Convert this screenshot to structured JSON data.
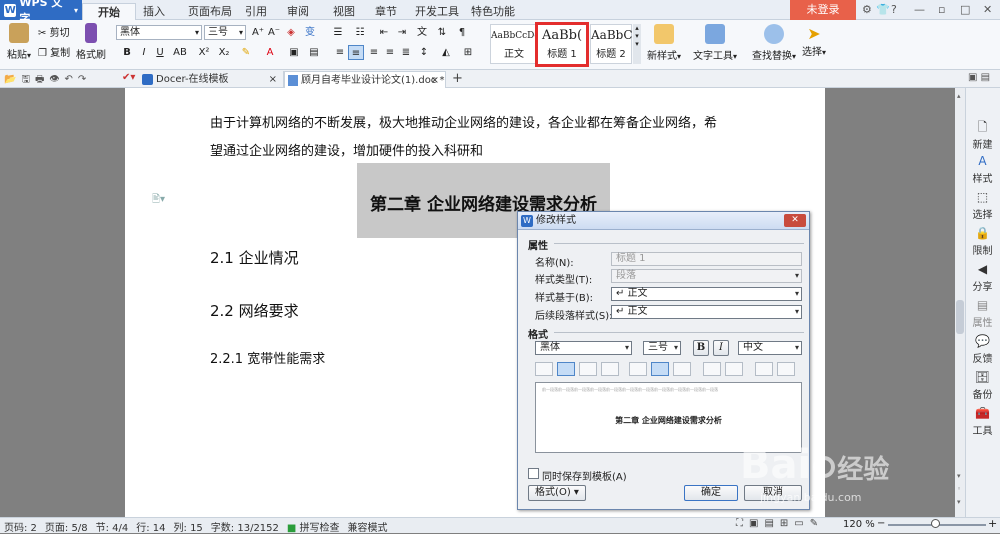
{
  "app": {
    "brand": "WPS 文字",
    "login": "未登录"
  },
  "menu_tabs": [
    "开始",
    "插入",
    "页面布局",
    "引用",
    "审阅",
    "视图",
    "章节",
    "开发工具",
    "特色功能"
  ],
  "ribbon": {
    "paste": "粘贴",
    "cut": "剪切",
    "copy": "复制",
    "format_painter": "格式刷",
    "font": "黑体",
    "size": "三号",
    "styles": [
      {
        "preview": "AaBbCcDd",
        "name": "正文"
      },
      {
        "preview": "AaBb(",
        "name": "标题 1"
      },
      {
        "preview": "AaBbC",
        "name": "标题 2"
      }
    ],
    "new_style": "新样式",
    "text_tools": "文字工具",
    "find_replace": "查找替换",
    "select": "选择"
  },
  "doc_tabs": [
    "Docer-在线模板",
    "顾月自考毕业设计论文(1).doc *"
  ],
  "document": {
    "para1_line1": "由于计算机网络的不断发展，极大地推动企业网络的建设，各企业都在筹备企业网络，希",
    "para1_line2": "望通过企业网络的建设，增加硬件的投入科研和",
    "chapter_heading": "第二章  企业网络建设需求分析",
    "h2_1": "2.1 企业情况",
    "h2_2": "2.2 网络要求",
    "h3_1": "2.2.1 宽带性能需求"
  },
  "sidebar": [
    "新建",
    "样式",
    "选择",
    "限制",
    "分享",
    "属性",
    "反馈",
    "备份",
    "工具"
  ],
  "status": {
    "page_no": "页码: 2",
    "pages": "页面: 5/8",
    "section": "节: 4/4",
    "row": "行: 14",
    "col": "列: 15",
    "words": "字数: 13/2152",
    "spell": "拼写检查",
    "compat": "兼容模式",
    "zoom": "120 %"
  },
  "dialog": {
    "title": "修改样式",
    "props_group": "属性",
    "name_label": "名称(N):",
    "name_value": "标题 1",
    "type_label": "样式类型(T):",
    "type_value": "段落",
    "based_label": "样式基于(B):",
    "based_value": "↵ 正文",
    "next_label": "后续段落样式(S):",
    "next_value": "↵ 正文",
    "format_group": "格式",
    "font": "黑体",
    "size": "三号",
    "bold": "B",
    "italic": "I",
    "lang": "中文",
    "preview_sample": "前一段落前一段落前一段落前一段落前一段落前一段落前一段落前一段落前一段落前一段落前一段落",
    "preview_text": "第二章  企业网络建设需求分析",
    "save_template": "同时保存到模板(A)",
    "format_btn": "格式(O)",
    "ok": "确定",
    "cancel": "取消"
  },
  "watermark": {
    "brand": "Bai",
    "brand2": "经验",
    "url": "jingyan.baidu.com"
  },
  "colors": {
    "accent": "#2f6cc4",
    "login": "#e8614a",
    "highlight_box": "#e32d2d",
    "heading_bg": "#c8c8c8"
  }
}
